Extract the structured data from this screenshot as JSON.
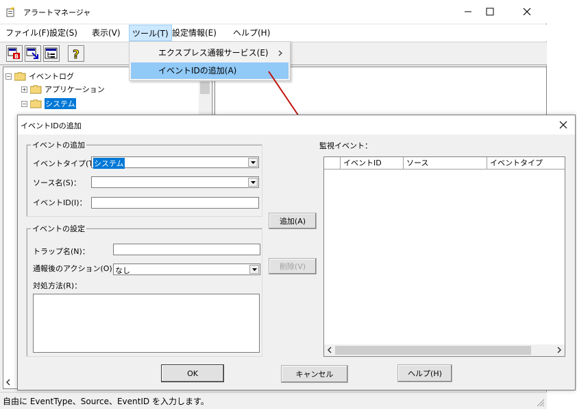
{
  "main_window": {
    "title": "アラートマネージャ",
    "menu": [
      "ファイル(F)",
      "設定(S)",
      "表示(V)",
      "ツール(T)",
      "設定情報(E)",
      "ヘルプ(H)"
    ],
    "toolbar_icons": [
      "settings-red-icon",
      "import-icon",
      "tree-view-icon",
      "help-icon"
    ],
    "tree": {
      "root": "イベントログ",
      "children": [
        "アプリケーション",
        "システム"
      ]
    },
    "status_text": "自由に EventType、Source、EventID を入力します。"
  },
  "tools_menu": {
    "items": [
      "エクスプレス通報サービス(E)",
      "イベントIDの追加(A)"
    ],
    "highlighted": "イベントIDの追加(A)"
  },
  "dialog": {
    "title": "イベントIDの追加",
    "add_group": {
      "label": "イベントの追加",
      "event_type_label": "イベントタイプ(T)：",
      "event_type_value": "システム",
      "source_label": "ソース名(S)：",
      "source_value": "",
      "event_id_label": "イベントID(I)：",
      "event_id_value": ""
    },
    "settings_group": {
      "label": "イベントの設定",
      "trap_label": "トラップ名(N)：",
      "trap_value": "",
      "action_label": "通報後のアクション(O)：",
      "action_value": "なし",
      "method_label": "対処方法(R)："
    },
    "add_button": "追加(A)",
    "delete_button": "削除(V)",
    "monitor_label": "監視イベント：",
    "columns": [
      "",
      "イベントID",
      "ソース",
      "イベントタイプ"
    ],
    "ok_button": "OK",
    "cancel_button": "キャンセル",
    "help_button": "ヘルプ(H)"
  },
  "colors": {
    "menu_highlight": "#cce8ff",
    "dropdown_highlight": "#91c9f7",
    "arrow": "#c0120b",
    "selection": "#0078d7"
  }
}
